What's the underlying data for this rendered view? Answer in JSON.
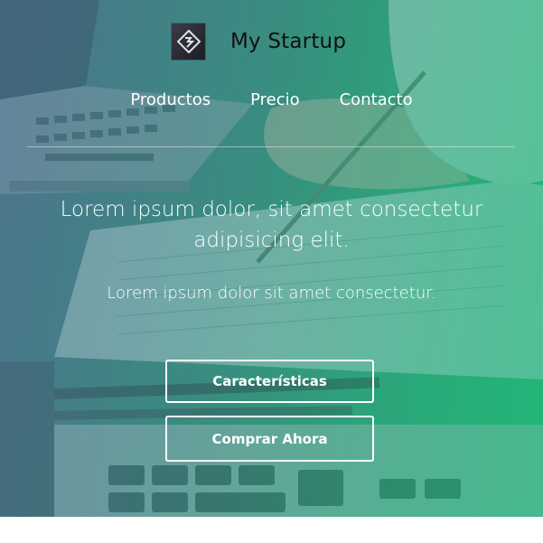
{
  "brand": {
    "name": "My Startup",
    "logo_icon": "logo-icon"
  },
  "nav": {
    "items": [
      {
        "label": "Productos"
      },
      {
        "label": "Precio"
      },
      {
        "label": "Contacto"
      }
    ]
  },
  "hero": {
    "headline": "Lorem ipsum dolor, sit amet consectetur adipisicing elit.",
    "subheadline": "Lorem ipsum dolor sit amet consectetur.",
    "buttons": {
      "features_label": "Características",
      "buy_label": "Comprar Ahora"
    },
    "colors": {
      "gradient_start": "#4a6f86",
      "gradient_end": "#27b877",
      "text": "#ffffff"
    }
  }
}
